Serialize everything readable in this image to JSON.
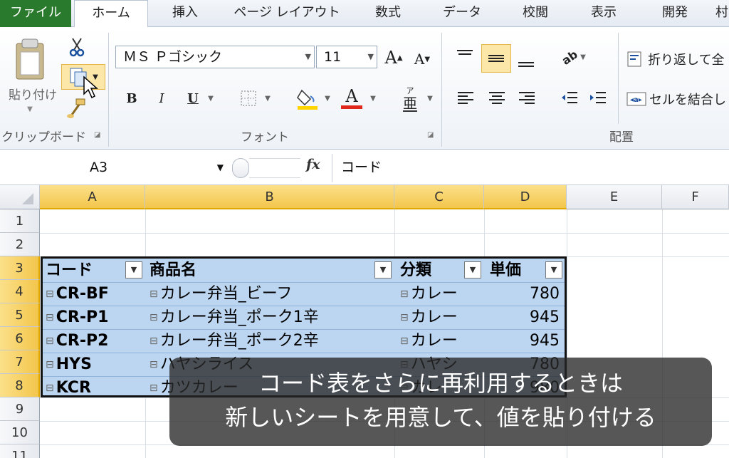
{
  "tabs": [
    "ファイル",
    "ホーム",
    "挿入",
    "ページ レイアウト",
    "数式",
    "データ",
    "校閲",
    "表示",
    "開発",
    "村"
  ],
  "ribbon": {
    "clipboard": {
      "paste_label": "貼り付け",
      "group_label": "クリップボード"
    },
    "font": {
      "font_name": "ＭＳ Ｐゴシック",
      "font_size": "11",
      "bold": "B",
      "italic": "I",
      "underline": "U",
      "group_label": "フォント"
    },
    "alignment": {
      "wrap_text": "折り返して全",
      "merge": "セルを結合し",
      "group_label": "配置"
    },
    "colors": {
      "fill": "#ffd400",
      "font_color": "#e0271b",
      "accent_green": "#2a7a2d"
    }
  },
  "formula_bar": {
    "name_box": "A3",
    "fx": "fx",
    "content": "コード"
  },
  "columns": [
    "A",
    "B",
    "C",
    "D",
    "E",
    "F"
  ],
  "rows": [
    "1",
    "2",
    "3",
    "4",
    "5",
    "6",
    "7",
    "8",
    "9",
    "10",
    "11"
  ],
  "table": {
    "headers": [
      "コード",
      "商品名",
      "分類",
      "単価"
    ],
    "rows": [
      [
        "CR-BF",
        "カレー弁当_ビーフ",
        "カレー",
        "780"
      ],
      [
        "CR-P1",
        "カレー弁当_ポーク1辛",
        "カレー",
        "945"
      ],
      [
        "CR-P2",
        "カレー弁当_ポーク2辛",
        "カレー",
        "945"
      ],
      [
        "HYS",
        "ハヤシライス",
        "ハヤシ",
        "780"
      ],
      [
        "KCR",
        "カツカレー",
        "カレー",
        "980"
      ]
    ]
  },
  "subtitle": {
    "line1": "コード表をさらに再利用するときは",
    "line2": "新しいシートを用意して、値を貼り付ける"
  }
}
